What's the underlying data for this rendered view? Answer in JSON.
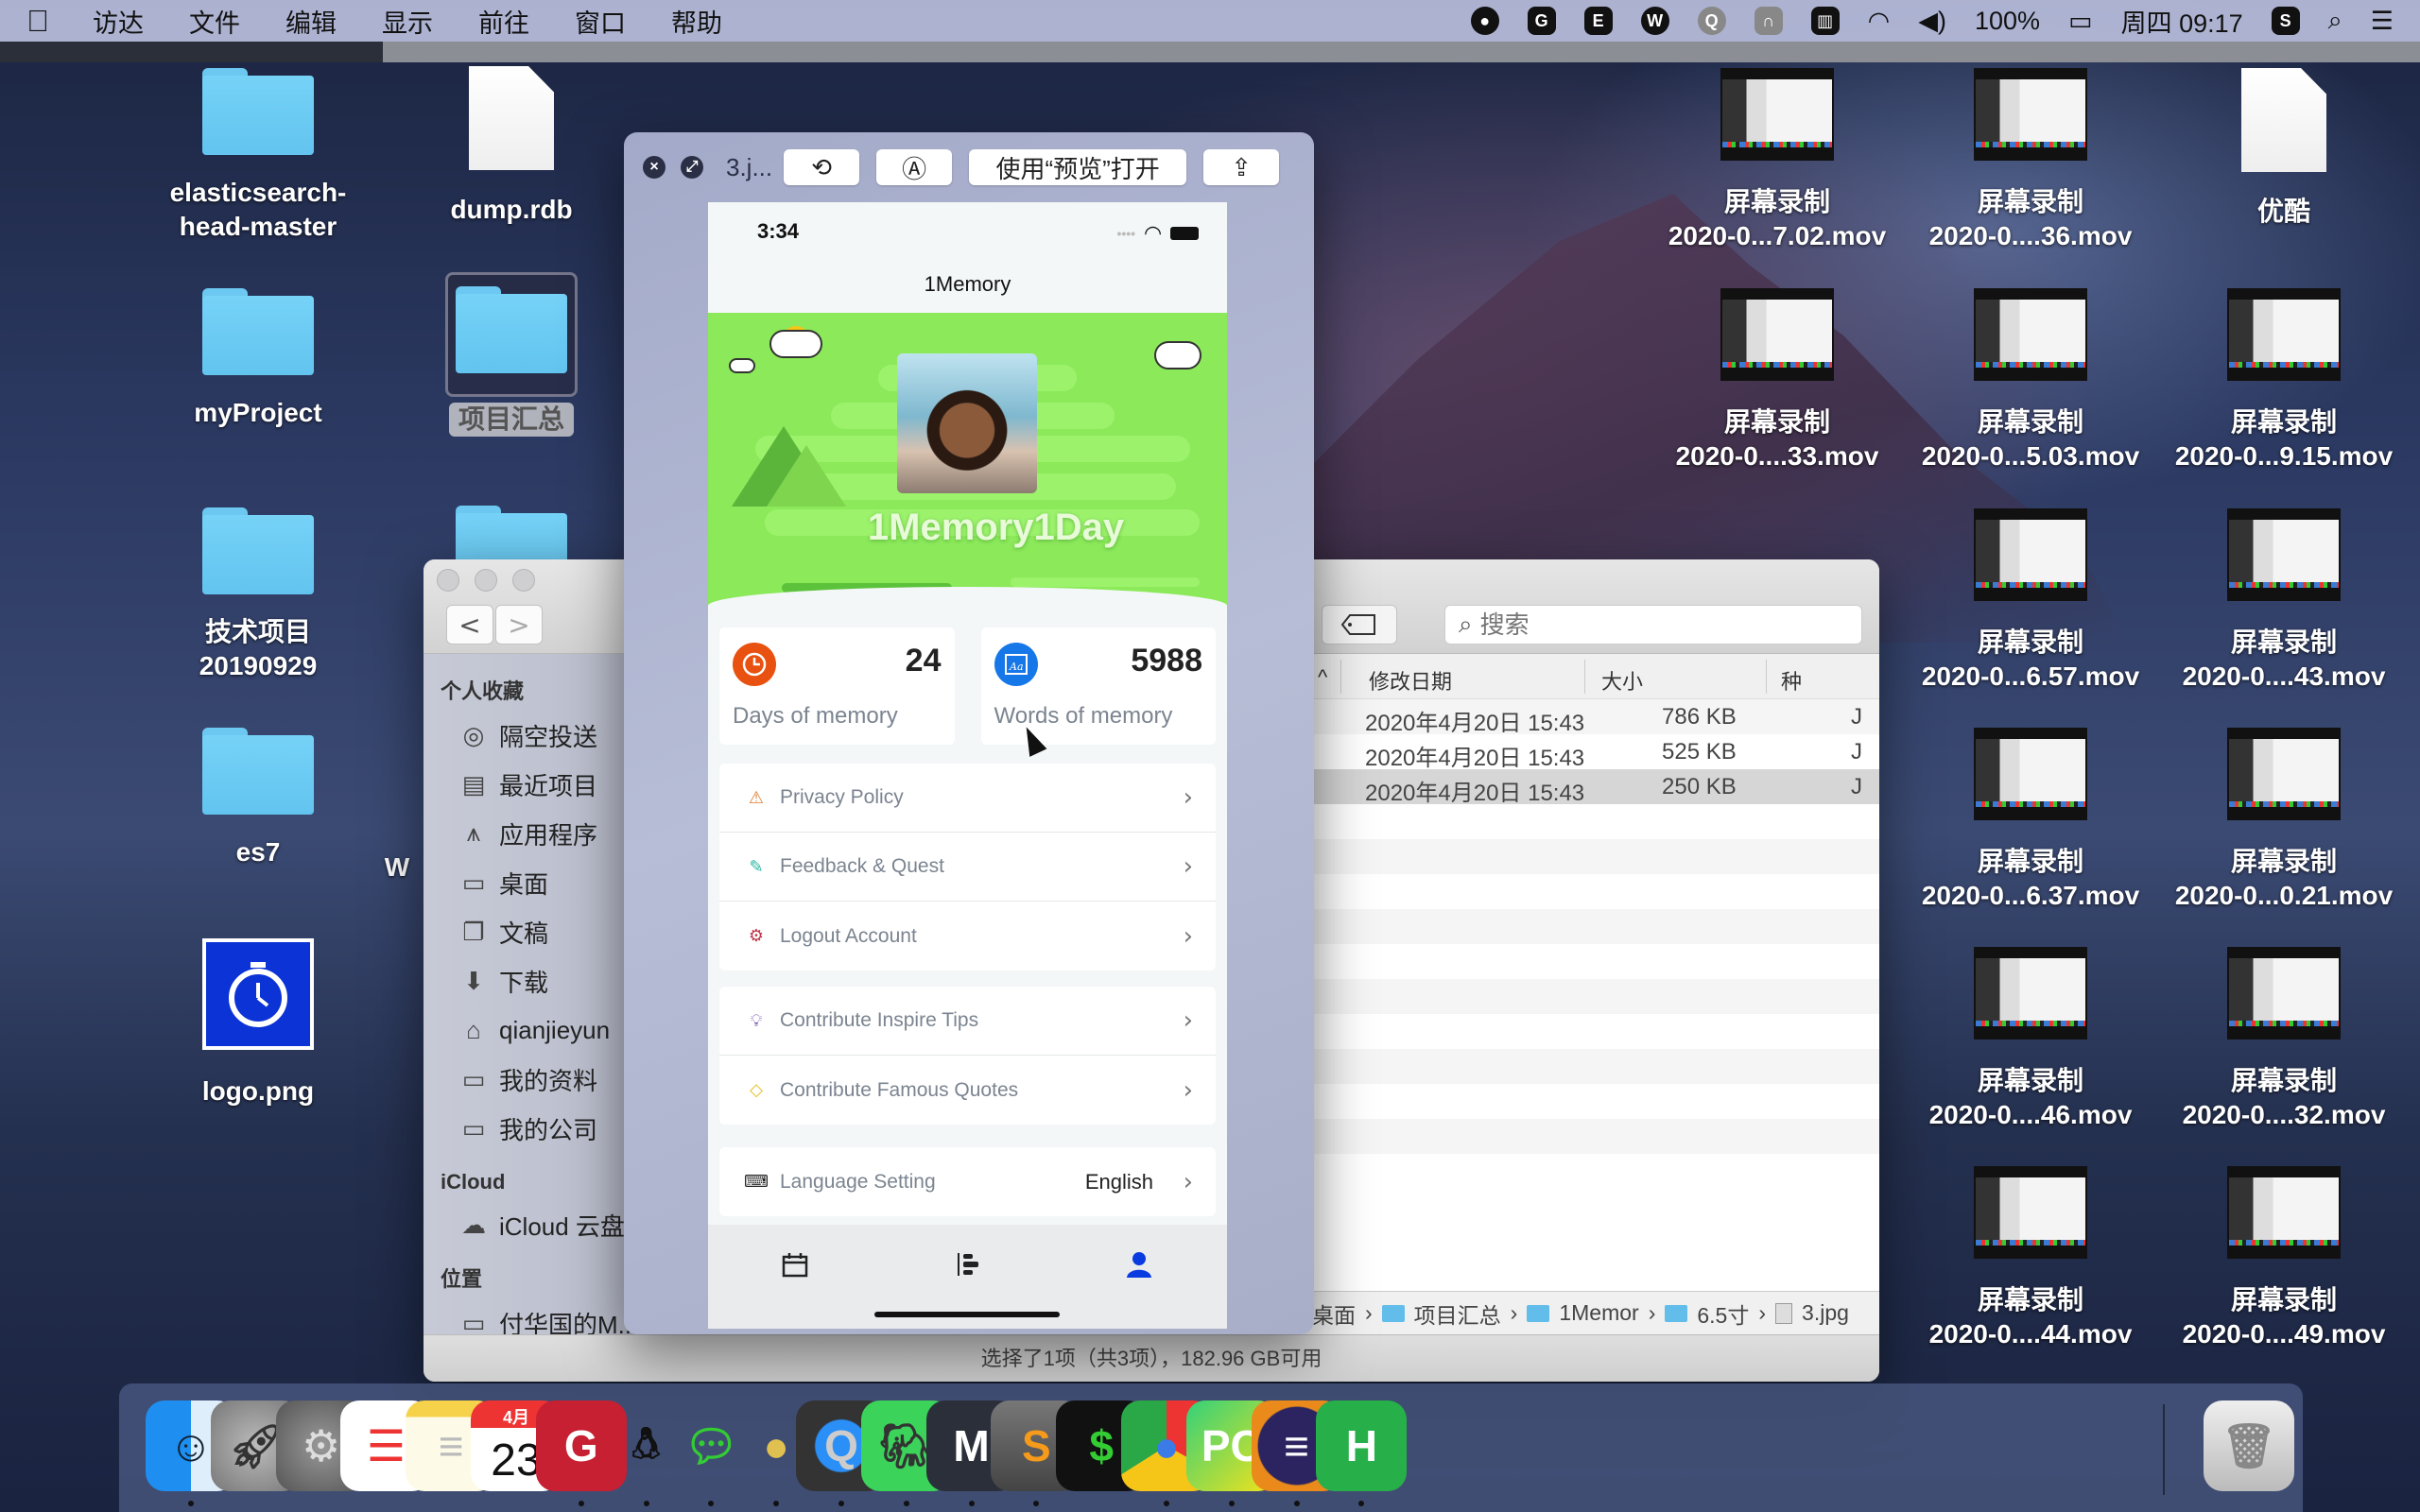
{
  "menubar": {
    "apple": "",
    "items": [
      "访达",
      "文件",
      "编辑",
      "显示",
      "前往",
      "窗口",
      "帮助"
    ],
    "status_icons": [
      "record-icon",
      "g-app-icon",
      "evernote-icon",
      "wechat-icon",
      "qq-icon",
      "vpn-icon",
      "keyboard-icon",
      "wifi-icon",
      "volume-icon"
    ],
    "battery": "100%",
    "clock": "周四 09:17"
  },
  "desktop": {
    "left_icons": [
      {
        "label": "elasticsearch-\nhead-master",
        "type": "folder"
      },
      {
        "label": "dump.rdb",
        "type": "document"
      },
      {
        "label": "myProject",
        "type": "folder"
      },
      {
        "label": "项目汇总",
        "type": "folder",
        "selected": true
      },
      {
        "label": "技术项目\n20190929",
        "type": "folder"
      },
      {
        "label": "es7",
        "type": "folder"
      },
      {
        "label": "logo.png",
        "type": "image"
      },
      {
        "label": "W",
        "type": "partial"
      }
    ],
    "right_icons": [
      {
        "line1": "屏幕录制",
        "line2": "2020-0...7.02.mov"
      },
      {
        "line1": "屏幕录制",
        "line2": "2020-0....36.mov"
      },
      {
        "line1": "优酷",
        "line2": ""
      },
      {
        "line1": "屏幕录制",
        "line2": "2020-0....33.mov"
      },
      {
        "line1": "屏幕录制",
        "line2": "2020-0...5.03.mov"
      },
      {
        "line1": "屏幕录制",
        "line2": "2020-0...9.15.mov"
      },
      {
        "line1": "屏幕录制",
        "line2": "2020-0...6.57.mov"
      },
      {
        "line1": "屏幕录制",
        "line2": "2020-0....43.mov"
      },
      {
        "line1": "屏幕录制",
        "line2": "2020-0...6.37.mov"
      },
      {
        "line1": "屏幕录制",
        "line2": "2020-0...0.21.mov"
      },
      {
        "line1": "屏幕录制",
        "line2": "2020-0....46.mov"
      },
      {
        "line1": "屏幕录制",
        "line2": "2020-0....32.mov"
      },
      {
        "line1": "屏幕录制",
        "line2": "2020-0....44.mov"
      },
      {
        "line1": "屏幕录制",
        "line2": "2020-0....49.mov"
      }
    ]
  },
  "finder": {
    "nav_back": "<",
    "nav_forward": ">",
    "search_placeholder": "搜索",
    "sidebar": {
      "favorites_header": "个人收藏",
      "favorites": [
        "隔空投送",
        "最近项目",
        "应用程序",
        "桌面",
        "文稿",
        "下载",
        "qianjieyun",
        "我的资料",
        "我的公司"
      ],
      "icloud_header": "iCloud",
      "icloud": [
        "iCloud 云盘"
      ],
      "locations_header": "位置",
      "locations": [
        "付华国的M..."
      ]
    },
    "columns": {
      "sort_arrow": "^",
      "modified": "修改日期",
      "size": "大小",
      "kind": "种"
    },
    "rows": [
      {
        "modified": "2020年4月20日 15:43",
        "size": "786 KB",
        "kind": "J"
      },
      {
        "modified": "2020年4月20日 15:43",
        "size": "525 KB",
        "kind": "J"
      },
      {
        "modified": "2020年4月20日 15:43",
        "size": "250 KB",
        "kind": "J",
        "selected": true
      }
    ],
    "path": [
      "桌面",
      "项目汇总",
      "1Memor",
      "6.5寸",
      "3.jpg"
    ],
    "status": "选择了1项（共3项），182.96 GB可用"
  },
  "quicklook": {
    "title": "3.j...",
    "open_with": "使用“预览”打开"
  },
  "app": {
    "status_time": "3:34",
    "nav_title": "1Memory",
    "brand": "1Memory1Day",
    "stats": [
      {
        "value": "24",
        "label": "Days of memory",
        "icon": "clock-icon",
        "color": "#e8510f"
      },
      {
        "value": "5988",
        "label": "Words of memory",
        "icon": "font-icon",
        "color": "#1677e8"
      }
    ],
    "menu_group1": [
      {
        "label": "Privacy Policy",
        "icon": "warning-icon",
        "color": "#e07a2a"
      },
      {
        "label": "Feedback & Quest",
        "icon": "pencil-icon",
        "color": "#2bb5a0"
      },
      {
        "label": "Logout Account",
        "icon": "gear-icon",
        "color": "#c0364a"
      }
    ],
    "menu_group2": [
      {
        "label": "Contribute Inspire Tips",
        "icon": "lightbulb-icon",
        "color": "#6b3fa0"
      },
      {
        "label": "Contribute Famous Quotes",
        "icon": "diamond-icon",
        "color": "#e6c01f"
      }
    ],
    "language": {
      "label": "Language Setting",
      "value": "English",
      "icon": "keyboard-icon"
    },
    "chevron": "›",
    "tabs": [
      {
        "name": "calendar",
        "active": false
      },
      {
        "name": "timeline",
        "active": false
      },
      {
        "name": "profile",
        "active": true,
        "color": "#0a3be0"
      }
    ]
  },
  "dock": {
    "apps": [
      "Finder",
      "Launchpad",
      "System Preferences",
      "Reminders",
      "Notes",
      "Calendar",
      "Foxmail",
      "QQ",
      "WeChat",
      "Tuxera",
      "QuickTime",
      "Evernote",
      "MWeb",
      "Sublime Text",
      "Terminal",
      "Chrome",
      "PyCharm",
      "Eclipse",
      "HBuilder",
      "Trash"
    ],
    "calendar_month": "4月",
    "calendar_day": "23"
  }
}
